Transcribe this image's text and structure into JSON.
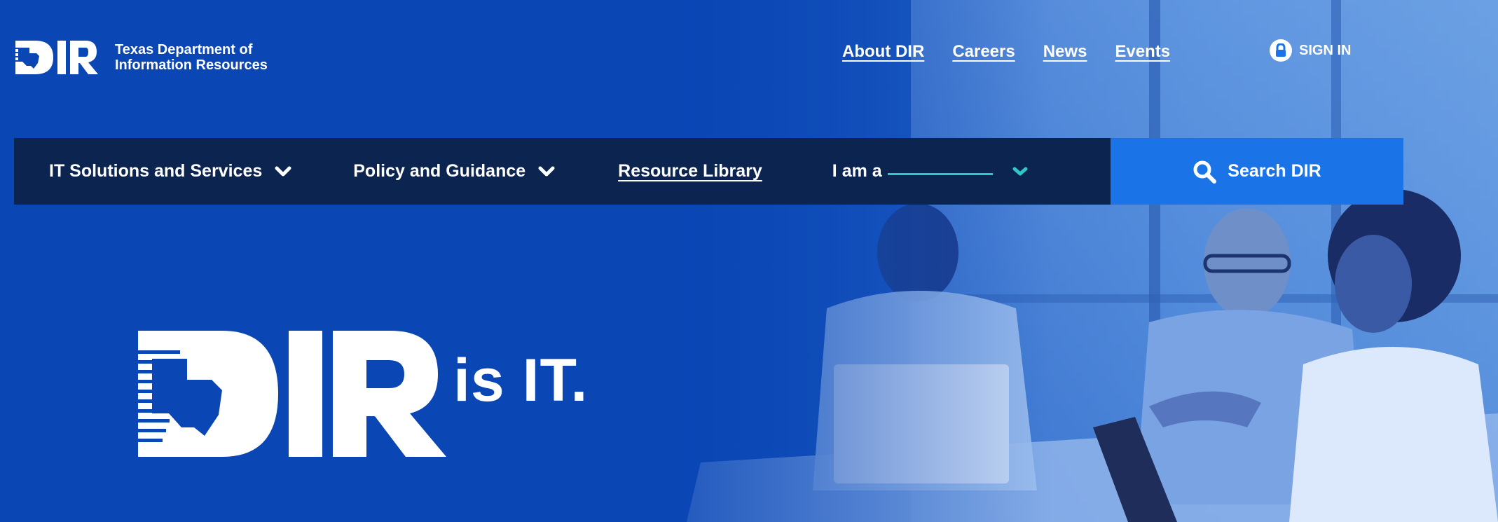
{
  "header": {
    "org_line1": "Texas Department of",
    "org_line2": "Information Resources",
    "links": [
      "About DIR",
      "Careers",
      "News",
      "Events"
    ],
    "signin_label": "SIGN IN"
  },
  "nav": {
    "items": [
      {
        "label": "IT Solutions and Services",
        "has_dropdown": true
      },
      {
        "label": "Policy and Guidance",
        "has_dropdown": true
      },
      {
        "label": "Resource Library",
        "has_dropdown": false
      }
    ],
    "iam_label": "I am a",
    "search_label": "Search DIR"
  },
  "hero": {
    "tagline": "is IT."
  },
  "colors": {
    "hero_blue": "#0a47b5",
    "nav_dark": "#0b2450",
    "search_blue": "#1b73e8",
    "accent_teal": "#2fc7c7"
  },
  "icons": [
    "texas-map-icon",
    "lock-icon",
    "chevron-down-icon",
    "search-icon"
  ]
}
